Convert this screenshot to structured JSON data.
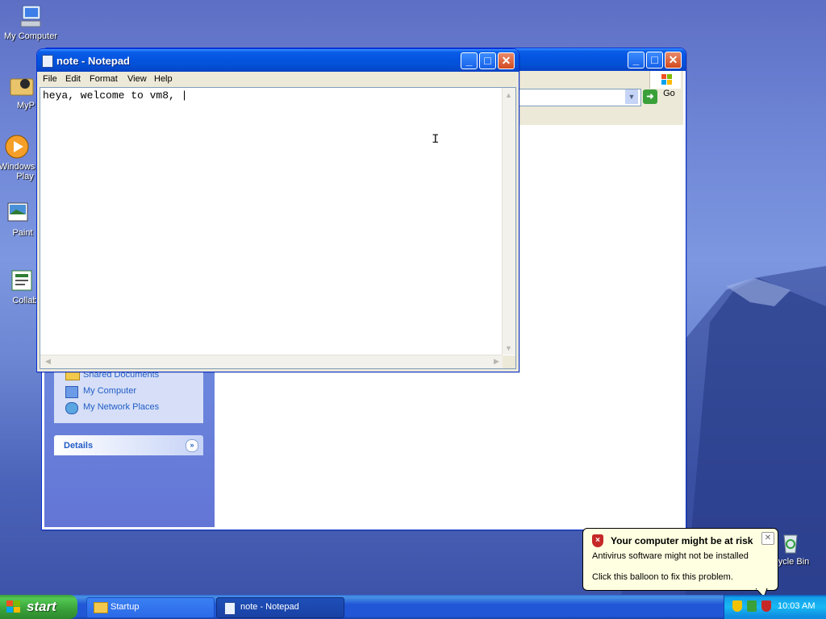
{
  "desktop": {
    "icons": [
      {
        "label": "My Computer"
      },
      {
        "label": "MyP"
      },
      {
        "label": "Windows",
        "label2": "Play"
      },
      {
        "label": "Paint"
      },
      {
        "label": "Collab"
      },
      {
        "label": "ycle Bin"
      }
    ]
  },
  "notepad": {
    "title": "note - Notepad",
    "menu": [
      "File",
      "Edit",
      "Format",
      "View",
      "Help"
    ],
    "content": "heya, welcome to vm8, |"
  },
  "explorer": {
    "go_label": "Go",
    "other_places": [
      "Shared Documents",
      "My Computer",
      "My Network Places"
    ],
    "details_label": "Details"
  },
  "taskbar": {
    "start_label": "start",
    "tasks": [
      "Startup",
      "note - Notepad"
    ],
    "clock": "10:03 AM"
  },
  "balloon": {
    "title": "Your computer might be at risk",
    "line1": "Antivirus software might not be installed",
    "line2": "Click this balloon to fix this problem."
  },
  "colors": {
    "titlebar": "#0454e0",
    "taskbar": "#2157d7",
    "start": "#3aa13a",
    "balloon": "#ffffe1",
    "link": "#215dc6"
  }
}
